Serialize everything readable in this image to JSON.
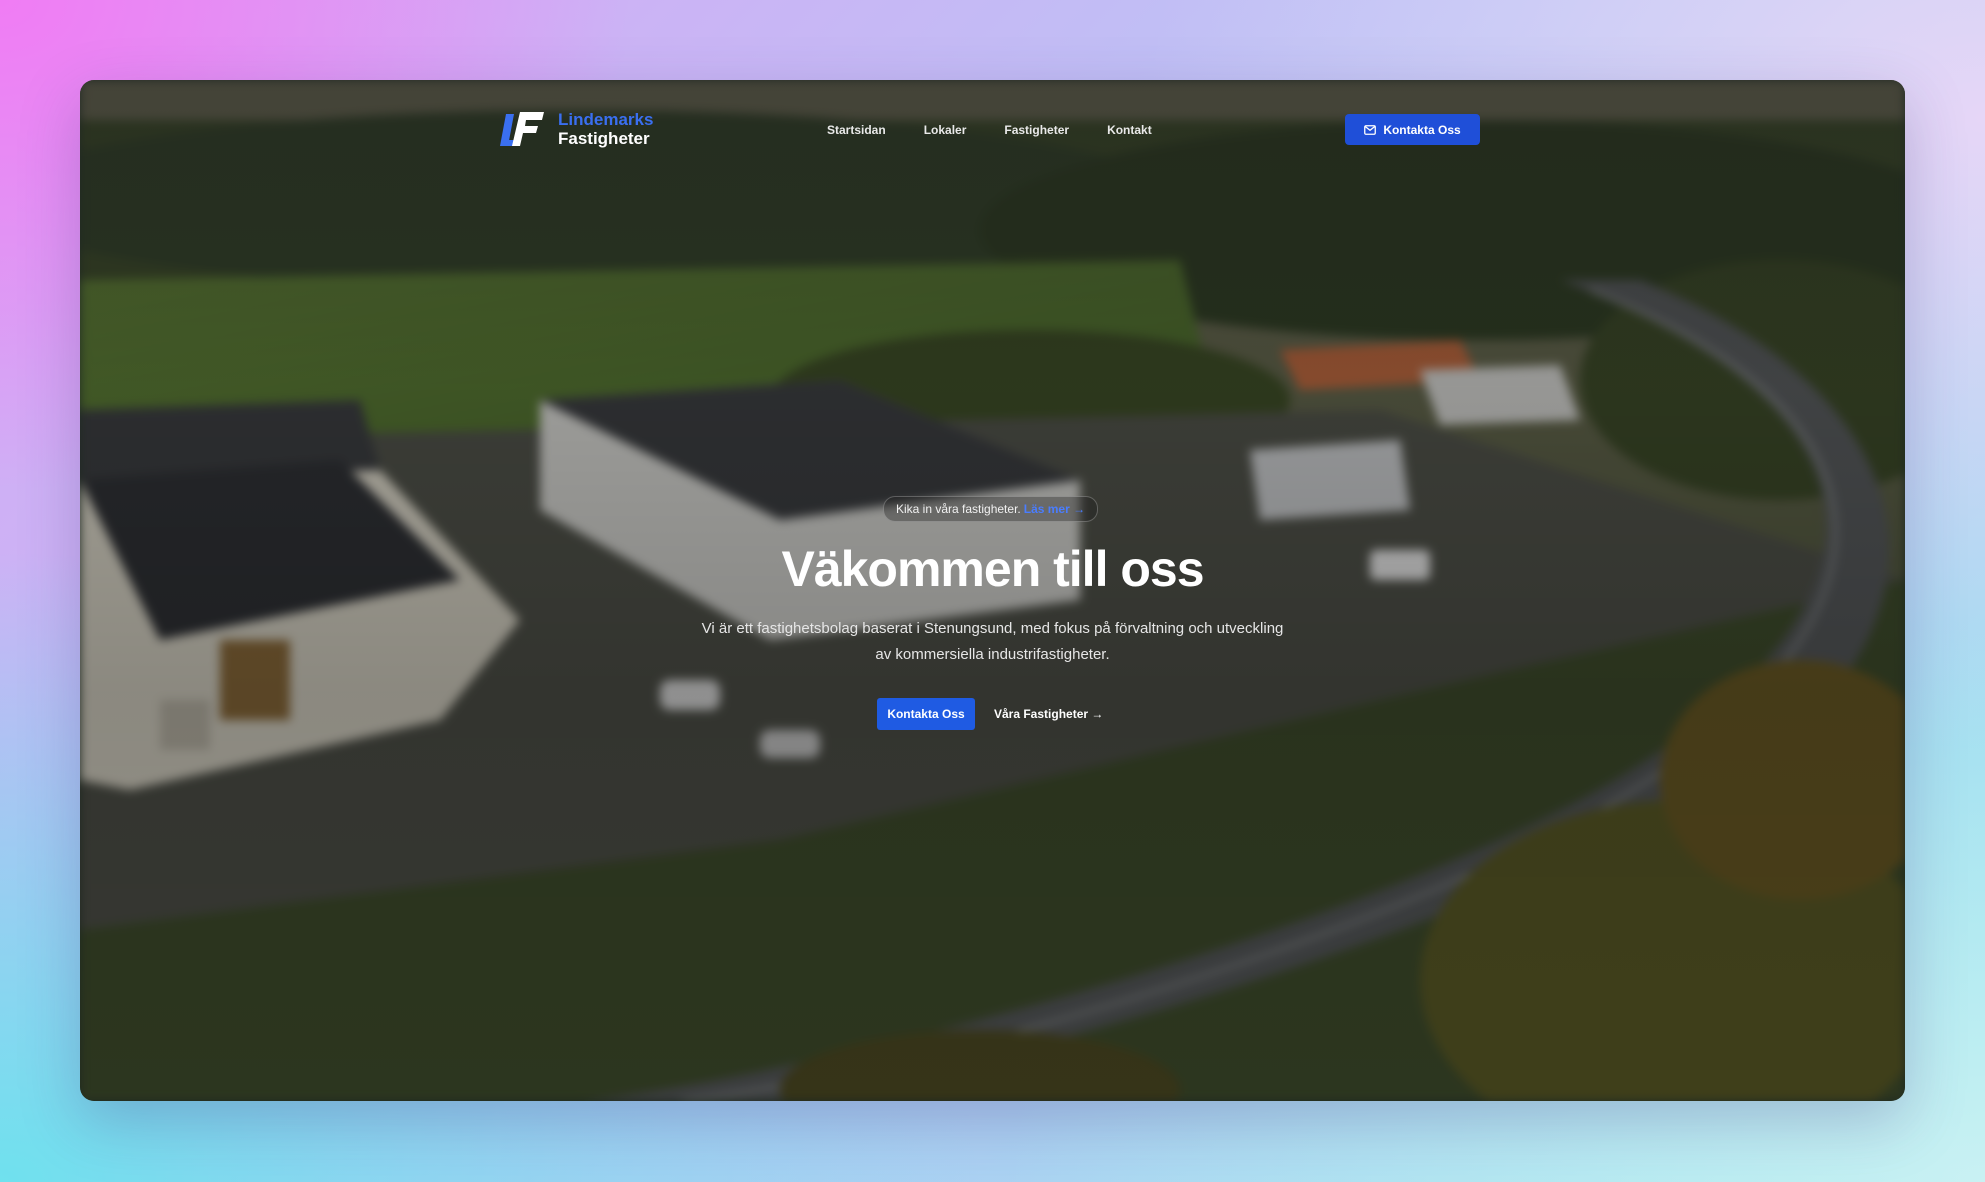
{
  "brand": {
    "line1": "Lindemarks",
    "line2": "Fastigheter",
    "logo_icon": "lf-logo-icon"
  },
  "nav": {
    "links": [
      "Startsidan",
      "Lokaler",
      "Fastigheter",
      "Kontakt"
    ],
    "cta_label": "Kontakta Oss",
    "cta_icon": "mail-icon"
  },
  "hero": {
    "pill_text": "Kika in våra fastigheter.",
    "pill_link": "Läs mer →",
    "title": "Väkommen till oss",
    "subtitle": "Vi är ett fastighetsbolag baserat i Stenungsund, med fokus på förvaltning och utveckling av kommersiella industrifastigheter.",
    "primary_button": "Kontakta Oss",
    "secondary_button": "Våra Fastigheter →"
  },
  "colors": {
    "accent": "#1f5be3",
    "logo_blue": "#3a6ff0"
  }
}
